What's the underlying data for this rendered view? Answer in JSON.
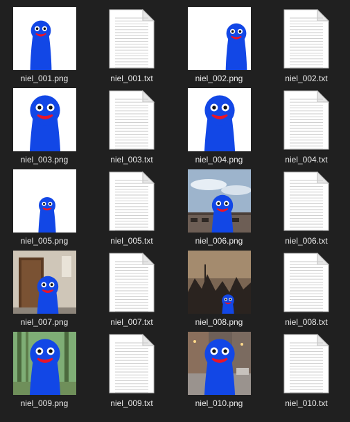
{
  "files": [
    {
      "name": "niel_001.png",
      "kind": "image",
      "scene": "white",
      "pos": "center-small"
    },
    {
      "name": "niel_001.txt",
      "kind": "text"
    },
    {
      "name": "niel_002.png",
      "kind": "image",
      "scene": "white",
      "pos": "right-small"
    },
    {
      "name": "niel_002.txt",
      "kind": "text"
    },
    {
      "name": "niel_003.png",
      "kind": "image",
      "scene": "white",
      "pos": "center-large"
    },
    {
      "name": "niel_003.txt",
      "kind": "text"
    },
    {
      "name": "niel_004.png",
      "kind": "image",
      "scene": "white",
      "pos": "center-large"
    },
    {
      "name": "niel_004.txt",
      "kind": "text"
    },
    {
      "name": "niel_005.png",
      "kind": "image",
      "scene": "white",
      "pos": "center-small-low"
    },
    {
      "name": "niel_005.txt",
      "kind": "text"
    },
    {
      "name": "niel_006.png",
      "kind": "image",
      "scene": "sky-building",
      "pos": "center-medium"
    },
    {
      "name": "niel_006.txt",
      "kind": "text"
    },
    {
      "name": "niel_007.png",
      "kind": "image",
      "scene": "doorway",
      "pos": "center-medium"
    },
    {
      "name": "niel_007.txt",
      "kind": "text"
    },
    {
      "name": "niel_008.png",
      "kind": "image",
      "scene": "dusk-town",
      "pos": "center-tiny"
    },
    {
      "name": "niel_008.txt",
      "kind": "text"
    },
    {
      "name": "niel_009.png",
      "kind": "image",
      "scene": "forest",
      "pos": "center-large"
    },
    {
      "name": "niel_009.txt",
      "kind": "text"
    },
    {
      "name": "niel_010.png",
      "kind": "image",
      "scene": "street",
      "pos": "center-large"
    },
    {
      "name": "niel_010.txt",
      "kind": "text"
    }
  ],
  "colors": {
    "background": "#202020",
    "character": "#1247e6",
    "mouth": "#e8142a",
    "label": "#ececec"
  },
  "icons": {
    "text_file": "document-icon",
    "image_file": "image-thumbnail"
  }
}
